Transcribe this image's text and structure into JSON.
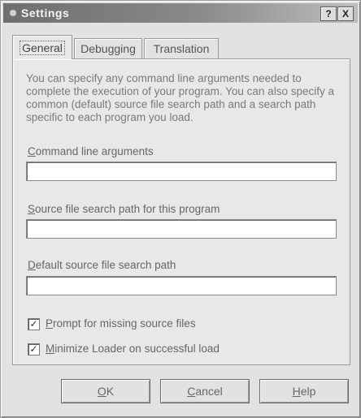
{
  "window": {
    "title": "Settings"
  },
  "titlebar_buttons": {
    "help": "?",
    "close": "X"
  },
  "tabs": [
    {
      "label": "General",
      "active": true
    },
    {
      "label": "Debugging",
      "active": false
    },
    {
      "label": "Translation",
      "active": false
    }
  ],
  "general": {
    "description": "You can specify any command line arguments needed to complete the execution of your program. You can also specify a common (default) source file search path and a search path specific to each program you load.",
    "command_line_label": {
      "first": "C",
      "rest": "ommand line arguments"
    },
    "command_line_value": "",
    "source_path_label": {
      "first": "S",
      "rest": "ource file search path for this program"
    },
    "source_path_value": "",
    "default_path_label": {
      "first": "D",
      "rest": "efault source file search path"
    },
    "default_path_value": "",
    "prompt_missing": {
      "first": "P",
      "rest": "rompt for missing source files",
      "checked": true,
      "mark": "✓"
    },
    "minimize_loader": {
      "first": "M",
      "rest": "inimize Loader on successful load",
      "checked": true,
      "mark": "✓"
    }
  },
  "buttons": {
    "ok": {
      "first": "O",
      "rest": "K"
    },
    "cancel": {
      "first": "C",
      "rest": "ancel"
    },
    "help": {
      "first": "H",
      "rest": "elp"
    }
  }
}
